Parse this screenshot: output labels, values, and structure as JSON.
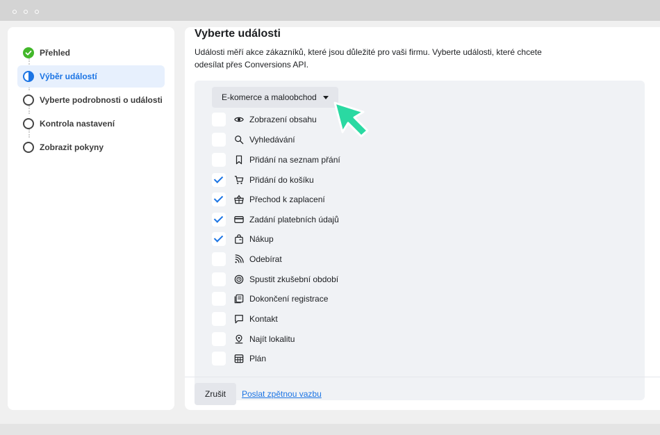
{
  "colors": {
    "accent": "#1b74e4",
    "success": "#42b72a",
    "cursor": "#2ad9a2"
  },
  "sidebar": {
    "steps": [
      {
        "label": "Přehled",
        "state": "done"
      },
      {
        "label": "Výběr událostí",
        "state": "current"
      },
      {
        "label": "Vyberte podrobnosti o události",
        "state": "pending"
      },
      {
        "label": "Kontrola nastavení",
        "state": "pending"
      },
      {
        "label": "Zobrazit pokyny",
        "state": "pending"
      }
    ]
  },
  "main": {
    "title": "Vyberte události",
    "description": "Události měří akce zákazníků, které jsou důležité pro vaši firmu. Vyberte události, které chcete odesílat přes Conversions API.",
    "dropdown": {
      "selected": "E-komerce a maloobchod"
    },
    "events": [
      {
        "label": "Zobrazení obsahu",
        "checked": false,
        "icon": "eye-icon"
      },
      {
        "label": "Vyhledávání",
        "checked": false,
        "icon": "search-icon"
      },
      {
        "label": "Přidání na seznam přání",
        "checked": false,
        "icon": "bookmark-icon"
      },
      {
        "label": "Přidání do košíku",
        "checked": true,
        "icon": "cart-icon"
      },
      {
        "label": "Přechod k zaplacení",
        "checked": true,
        "icon": "basket-icon"
      },
      {
        "label": "Zadání platebních údajů",
        "checked": true,
        "icon": "credit-card-icon"
      },
      {
        "label": "Nákup",
        "checked": true,
        "icon": "shopping-bag-icon"
      },
      {
        "label": "Odebírat",
        "checked": false,
        "icon": "rss-icon"
      },
      {
        "label": "Spustit zkušební období",
        "checked": false,
        "icon": "trial-clock-icon"
      },
      {
        "label": "Dokončení registrace",
        "checked": false,
        "icon": "registration-icon"
      },
      {
        "label": "Kontakt",
        "checked": false,
        "icon": "chat-bubble-icon"
      },
      {
        "label": "Najít lokalitu",
        "checked": false,
        "icon": "location-pin-icon"
      },
      {
        "label": "Plán",
        "checked": false,
        "icon": "calendar-grid-icon"
      }
    ]
  },
  "footer": {
    "cancel_label": "Zrušit",
    "feedback_label": "Poslat zpětnou vazbu"
  }
}
